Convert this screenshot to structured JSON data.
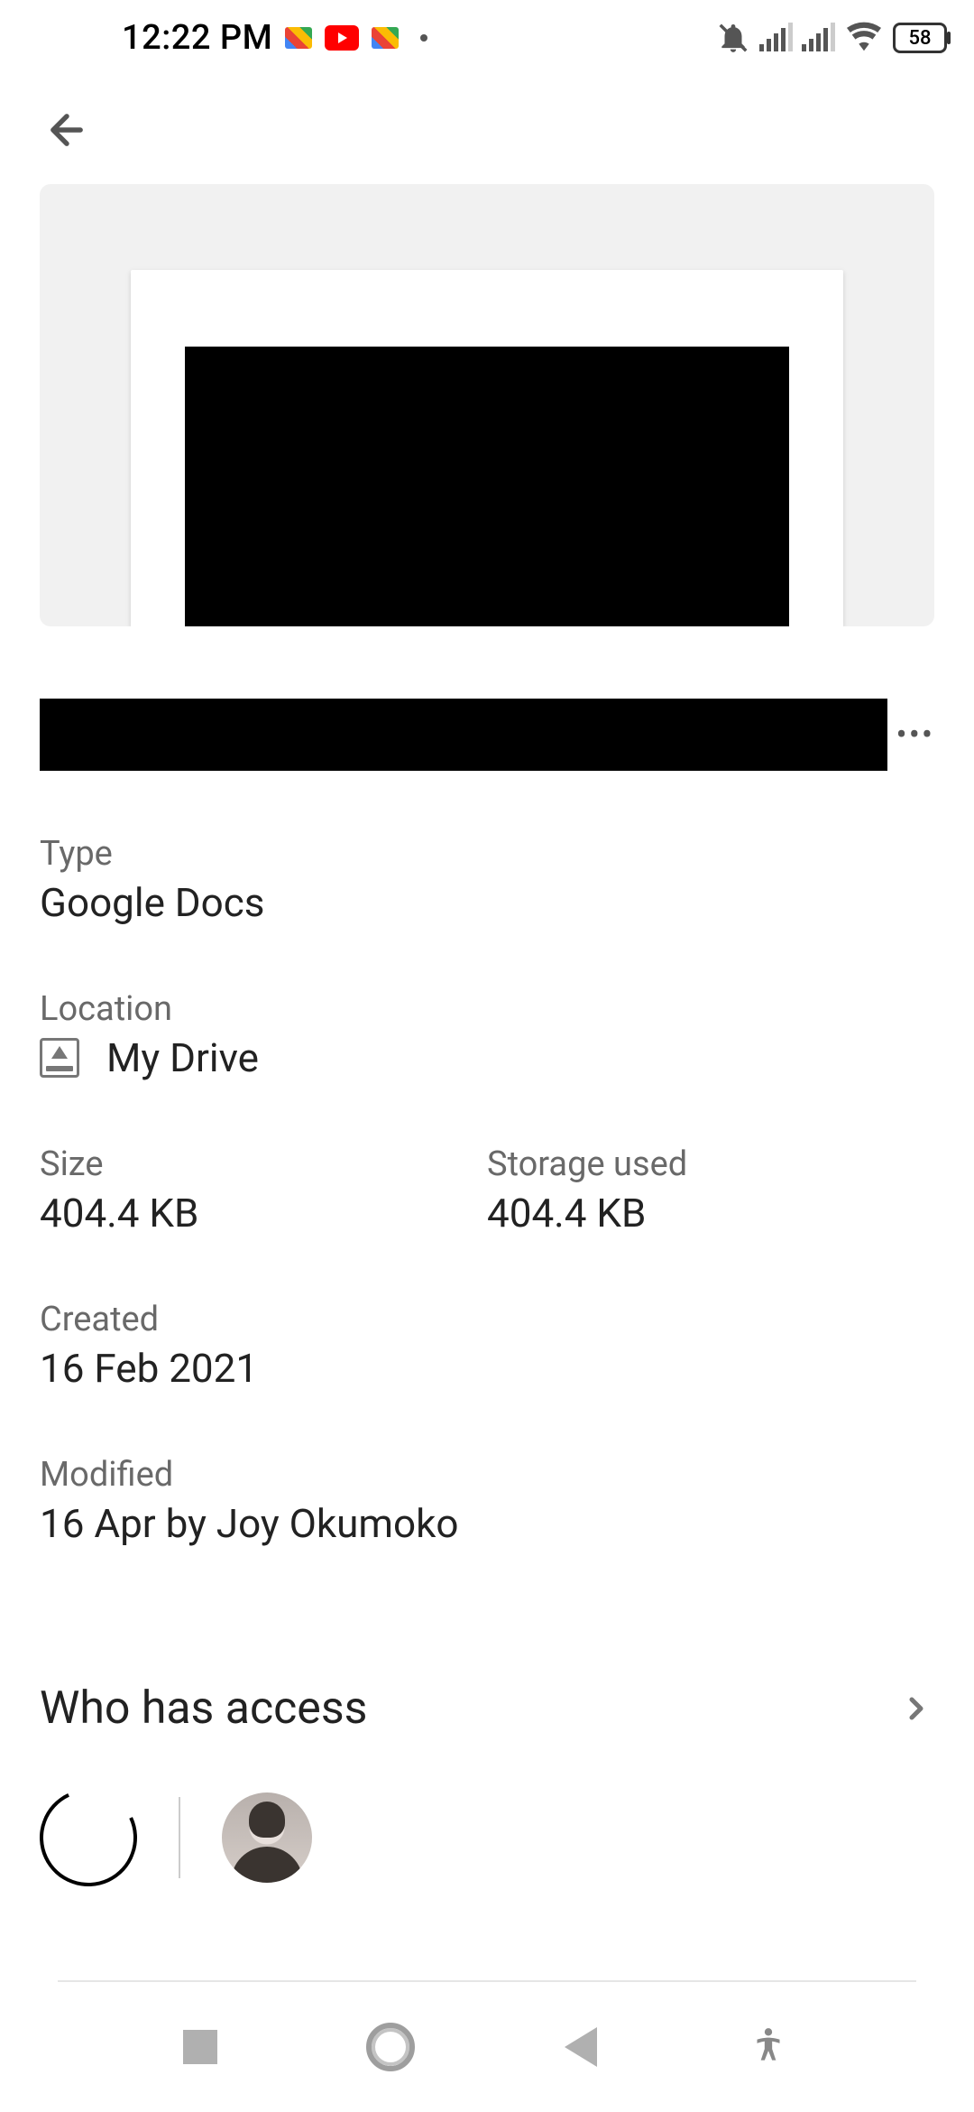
{
  "status_bar": {
    "time": "12:22 PM",
    "battery_pct": "58"
  },
  "details": {
    "type_label": "Type",
    "type_value": "Google Docs",
    "location_label": "Location",
    "location_value": "My Drive",
    "size_label": "Size",
    "size_value": "404.4 KB",
    "storage_label": "Storage used",
    "storage_value": "404.4 KB",
    "created_label": "Created",
    "created_value": "16 Feb 2021",
    "modified_label": "Modified",
    "modified_value": "16 Apr by Joy Okumoko"
  },
  "access": {
    "title": "Who has access"
  }
}
